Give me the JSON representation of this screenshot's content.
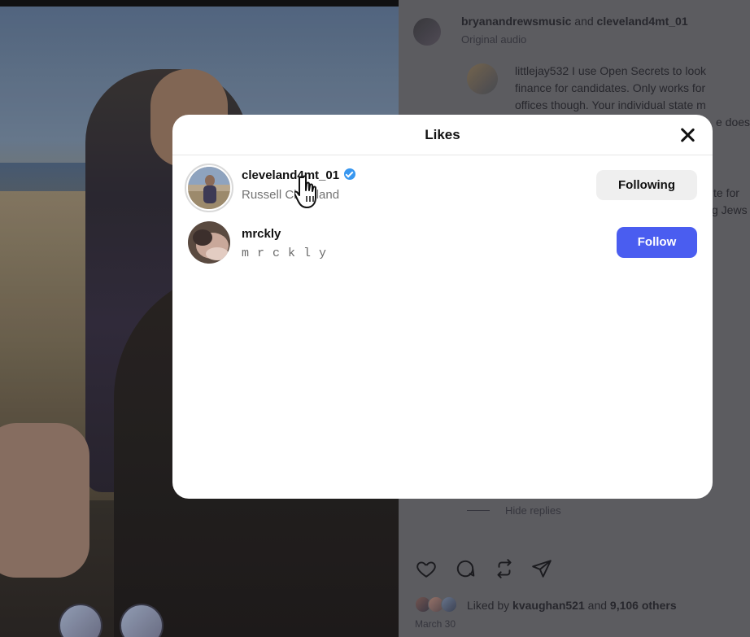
{
  "post": {
    "author_line_a": "bryanandrewsmusic",
    "author_and": " and ",
    "author_line_b": "cleveland4mt_01",
    "audio": "Original audio",
    "comment_user": "littlejay532",
    "comment_lines": [
      "I use Open Secrets to look",
      "finance for candidates. Only works for",
      "offices though. Your individual state m",
      "e does"
    ],
    "comment_tail": [
      "te for",
      "g Jews"
    ],
    "hide_replies": "Hide replies",
    "liked_by_prefix": "Liked by ",
    "liked_by_user": "kvaughan521",
    "liked_by_and": " and ",
    "liked_by_count": "9,106 others",
    "date": "March 30",
    "icons": [
      "heart-icon",
      "comment-icon",
      "repost-icon",
      "share-icon"
    ]
  },
  "likes_modal": {
    "title": "Likes",
    "users": [
      {
        "username": "cleveland4mt_01",
        "display_name": "Russell Cleveland",
        "verified": true,
        "button": "Following"
      },
      {
        "username": "mrckly",
        "display_name": "m r c k l y",
        "verified": false,
        "button": "Follow"
      }
    ]
  },
  "colors": {
    "follow_button": "#4a5df0",
    "following_button": "#efefef",
    "verified_badge": "#3897f0"
  }
}
